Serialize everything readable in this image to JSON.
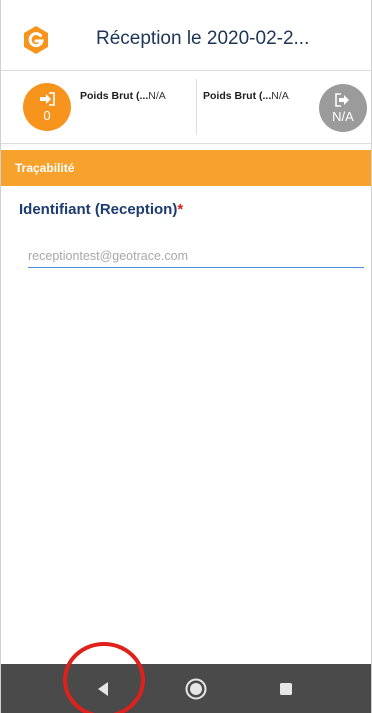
{
  "header": {
    "title": "Réception le 2020-02-2...",
    "logo_icon": "geotrace-logo-icon",
    "accent_color": "#f7941d"
  },
  "weights": {
    "in_button": {
      "icon": "sign-in-icon",
      "value": "0"
    },
    "label_1": {
      "name": "Poids Brut (...",
      "value": "N/A"
    },
    "label_2": {
      "name": "Poids Brut (...",
      "value": "N/A"
    },
    "out_button": {
      "icon": "sign-out-icon",
      "value": "N/A"
    }
  },
  "section": {
    "title": "Traçabilité"
  },
  "field": {
    "label": "Identifiant (Reception)",
    "required_mark": "*",
    "placeholder": "receptiontest@geotrace.com"
  },
  "navbar": {
    "back_icon": "back-triangle-icon",
    "home_icon": "home-circle-icon",
    "recent_icon": "recent-apps-square-icon",
    "highlight_color": "#e0201b"
  }
}
